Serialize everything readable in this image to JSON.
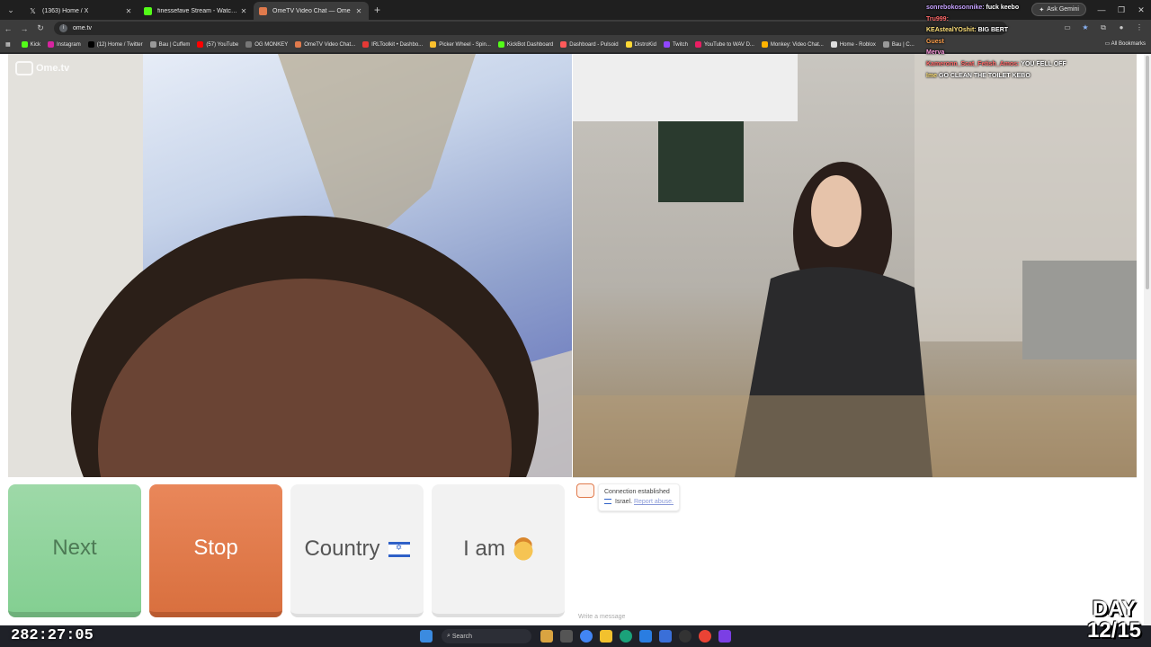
{
  "browser": {
    "tabs": [
      {
        "title": "(1363) Home / X",
        "active": false
      },
      {
        "title": "finessefave Stream - Watch Live",
        "active": false
      },
      {
        "title": "OmeTV Video Chat — Ome",
        "active": true
      }
    ],
    "address": "ome.tv",
    "gemini_label": "Ask Gemini",
    "bookmarks": [
      "Kick",
      "Instagram",
      "(12) Home / Twitter",
      "Bau | Cuffem",
      "(57) YouTube",
      "OG MONKEY",
      "OmeTV Video Chat...",
      "IRLToolkit • Dashbo...",
      "Picker Wheel - Spin...",
      "KickBot Dashboard",
      "Dashboard - Pulsoid",
      "DistroKid",
      "Twitch",
      "YouTube to WAV D...",
      "Monkey: Video Chat...",
      "Home - Roblox",
      "Bau | C..."
    ],
    "all_bookmarks": "All Bookmarks"
  },
  "site": {
    "logo_text": "Ome.tv",
    "buttons": {
      "next": "Next",
      "stop": "Stop",
      "country": "Country",
      "iam": "I am"
    },
    "chat": {
      "status": "Connection established",
      "country": "Israel.",
      "report": "Report abuse.",
      "placeholder": "Write a message"
    }
  },
  "stream_chat": [
    {
      "user": "sonrebokosonnike:",
      "text": "fuck keebo"
    },
    {
      "user": "Tru999:",
      "text": ""
    },
    {
      "user": "KEAstealYOshit:",
      "text": "BIG BERT"
    },
    {
      "user": "Guest",
      "text": ""
    },
    {
      "user": "Merva",
      "text": ""
    },
    {
      "user": "Kameronn_Scat_Fetish_Amos:",
      "text": "YOU FELL OFF"
    },
    {
      "user": "Ime",
      "text": "GO CLEAN THE TOILET KEBO"
    },
    {
      "user": "",
      "text": ""
    },
    {
      "user": "",
      "text": ""
    }
  ],
  "overlay": {
    "timer": "282:27:05",
    "day_label": "DAY",
    "day_count": "12/15"
  },
  "taskbar": {
    "search": "Search"
  },
  "colors": {
    "next": "#84cf92",
    "stop": "#d9703f",
    "neutral": "#f2f2f2"
  }
}
